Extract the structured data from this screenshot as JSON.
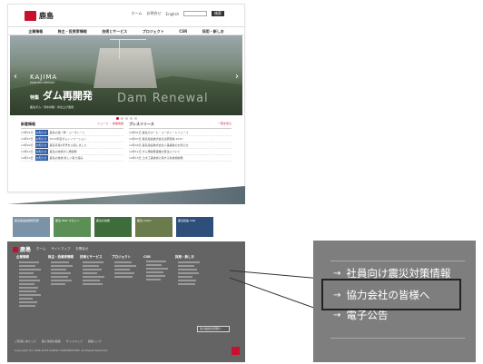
{
  "top_page": {
    "logo_text": "鹿島",
    "util_links": [
      "ホーム",
      "お問合せ",
      "English"
    ],
    "search_placeholder": "",
    "search_button": "検索",
    "nav": [
      "企業情報",
      "株主・投資家情報",
      "技術とサービス",
      "プロジェクト",
      "CSR",
      "採用・新しお"
    ],
    "hero": {
      "brand": "KAJIMA",
      "brand_sub": "MONTHLY REPORT",
      "title_prefix": "特集",
      "title": "ダム再開発",
      "english": "Dam Renewal",
      "caption": "鹿島ダム・洪水対策・水位上げ運用"
    },
    "news_left": {
      "title": "新着情報",
      "tabs": "ニュース ・ 新着情報",
      "rows": [
        {
          "date": "14年01日",
          "tag": "お知らせ",
          "text": "鹿島の第一陣・コーポレート"
        },
        {
          "date": "14年07日",
          "tag": "お知らせ",
          "text": "2013年度ダムイノベーション"
        },
        {
          "date": "14年02日",
          "tag": "お知らせ",
          "text": "鹿島月報2月号を公開しました"
        },
        {
          "date": "14年12日",
          "tag": "お知らせ",
          "text": "鹿島の技術ダム再開発"
        },
        {
          "date": "14年14日",
          "tag": "お知らせ",
          "text": "鹿島の技術 新しい取り組み"
        }
      ]
    },
    "news_right": {
      "title": "プレスリリース",
      "tabs": "一覧を見る",
      "rows": [
        {
          "date": "14年01日",
          "text": "鹿島のホーム・コーポレートニュース"
        },
        {
          "date": "14年07日",
          "text": "鹿島建設株式会社決算短信 2013"
        },
        {
          "date": "14年09日",
          "text": "鹿島建設株式会社人事異動のお知らせ"
        },
        {
          "date": "14年11日",
          "text": "ダム再開発事業の受注について"
        },
        {
          "date": "14年13日",
          "text": "土木工事技術に関する新技術開発"
        }
      ]
    }
  },
  "bottom_page": {
    "banners": [
      {
        "label": "鹿島建設技術研究所",
        "color": "#7b93a8"
      },
      {
        "label": "鹿島 Web マガジン",
        "color": "#5b8f55"
      },
      {
        "label": "鹿島の技術",
        "color": "#3d6d3a"
      },
      {
        "label": "鹿島 LOGO",
        "color": "#6a7b4c"
      },
      {
        "label": "鹿島建設 CSR",
        "color": "#2d4f7a"
      }
    ],
    "footer_logo": "鹿島",
    "footer_links": [
      "ホーム",
      "サイトマップ",
      "お問合せ"
    ],
    "footer_cols": [
      "企業情報",
      "株主・投資家情報",
      "技術とサービス",
      "プロジェクト",
      "CSR",
      "採用・新しお"
    ],
    "footer_highlight": "協力会社の皆様へ",
    "footer_bar": [
      "ご利用にあたって",
      "個人情報の取扱",
      "サイトマップ",
      "関連リンク"
    ],
    "copyright": "Copyright (C) 1996-2014 KAJIMA CORPORATION. All Rights Reserved."
  },
  "callout": {
    "items": [
      "社員向け震災対策情報",
      "協力会社の皆様へ",
      "電子公告"
    ],
    "arrow": "→",
    "highlighted_index": 1
  }
}
